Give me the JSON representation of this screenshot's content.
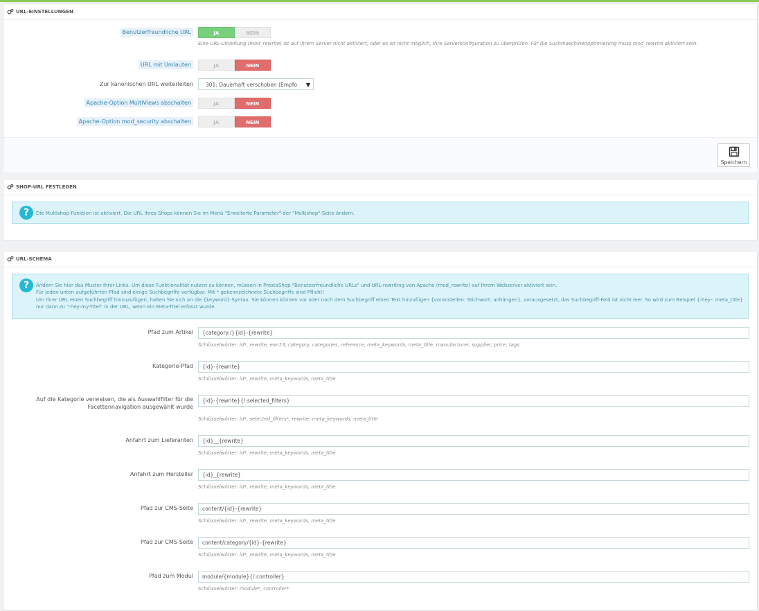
{
  "url_settings": {
    "heading": "URL-EINSTELLUNGEN",
    "friendly_url": {
      "label": "Benutzerfreundliche URL",
      "yes": "JA",
      "no": "NEIN",
      "help": "Eine URL-Umleitung (mod_rewrite) ist auf Ihrem Server nicht aktiviert, oder es ist nicht möglich, Ihre Serverkonfiguration zu überprüfen. Für die Suchmaschinenoptimierung muss mod_rewrite aktiviert sein."
    },
    "umlaut_url": {
      "label": "URL mit Umlauten",
      "yes": "JA",
      "no": "NEIN"
    },
    "canonical": {
      "label": "Zur kanonischen URL weiterleiten",
      "value": "301: Dauerhaft verschoben (Empfo"
    },
    "multiviews": {
      "label": "Apache-Option MultiViews abschalten",
      "yes": "JA",
      "no": "NEIN"
    },
    "mod_security": {
      "label": "Apache-Option mod_security abschalten",
      "yes": "JA",
      "no": "NEIN"
    },
    "save_label": "Speichern"
  },
  "shop_url": {
    "heading": "SHOP-URL FESTLEGEN",
    "info": "Die Multishop-Funktion ist aktiviert. Die URL Ihres Shops können Sie im Menü \"Erweiterte Parameter\" der \"Multishop\"-Seite ändern."
  },
  "url_schema": {
    "heading": "URL-SCHEMA",
    "info_line1": "Ändern Sie hier das Muster Ihrer Links. Um diese Funktionalität nutzen zu können, müssen in PrestaShop \"Benutzerfreundliche URLs\" und URL-rewriting von Apache (mod_rewrite) auf Ihrem Webserver aktiviert sein.",
    "info_line2": "Für jeden unten aufgeführten Pfad sind einige Suchbegriffe verfügbar. Mit * gekennzeichnete Suchbegriffe sind Pflicht!",
    "info_line3": "Um Ihrer URL einen Suchbegriff hinzuzufügen, halten Sie sich an die {keyword}-Syntax. Sie können können vor oder nach dem Suchbegriff einen Text hinzufügen {voranstellen: Stichwort: anhängen}, vorausgesetzt, das Suchbegriff-Feld ist nicht leer. So wird zum Beispiel {-hey-: meta_title} nur dann zu \"-hey-my-Titel\" in der URL, wenn ein Meta-Titel erfasst wurde.",
    "fields": [
      {
        "label": "Pfad zum Artikel",
        "value": "{category:/}{id}-{rewrite}",
        "keywords": "Schlüsselwörter: id*, rewrite, ean13, category, categories, reference, meta_keywords, meta_title, manufacturer, supplier, price, tags"
      },
      {
        "label": "Kategorie-Pfad",
        "value": "{id}-{rewrite}",
        "keywords": "Schlüsselwörter: id*, rewrite, meta_keywords, meta_title"
      },
      {
        "label": "Auf die Kategorie verweisen, die als Auswahlfilter für die Facettennavigation ausgewählt wurde",
        "value": "{id}-{rewrite}{/:selected_filters}",
        "keywords": "Schlüsselwörter: id*, selected_filters*, rewrite, meta_keywords, meta_title"
      },
      {
        "label": "Anfahrt zum Lieferanten",
        "value": "{id}__{rewrite}",
        "keywords": "Schlüsselwörter: id*, rewrite, meta_keywords, meta_title"
      },
      {
        "label": "Anfahrt zum Hersteller",
        "value": "{id}_{rewrite}",
        "keywords": "Schlüsselwörter: id*, rewrite, meta_keywords, meta_title"
      },
      {
        "label": "Pfad zur CMS-Seite",
        "value": "content/{id}-{rewrite}",
        "keywords": "Schlüsselwörter: id*, rewrite, meta_keywords, meta_title"
      },
      {
        "label": "Pfad zur CMS-Seite",
        "value": "content/category/{id}-{rewrite}",
        "keywords": "Schlüsselwörter: id*, rewrite, meta_keywords, meta_title"
      },
      {
        "label": "Pfad zum Modul",
        "value": "module/{module}{/:controller}",
        "keywords": "Schlüsselwörter: module*, controller*"
      }
    ]
  }
}
